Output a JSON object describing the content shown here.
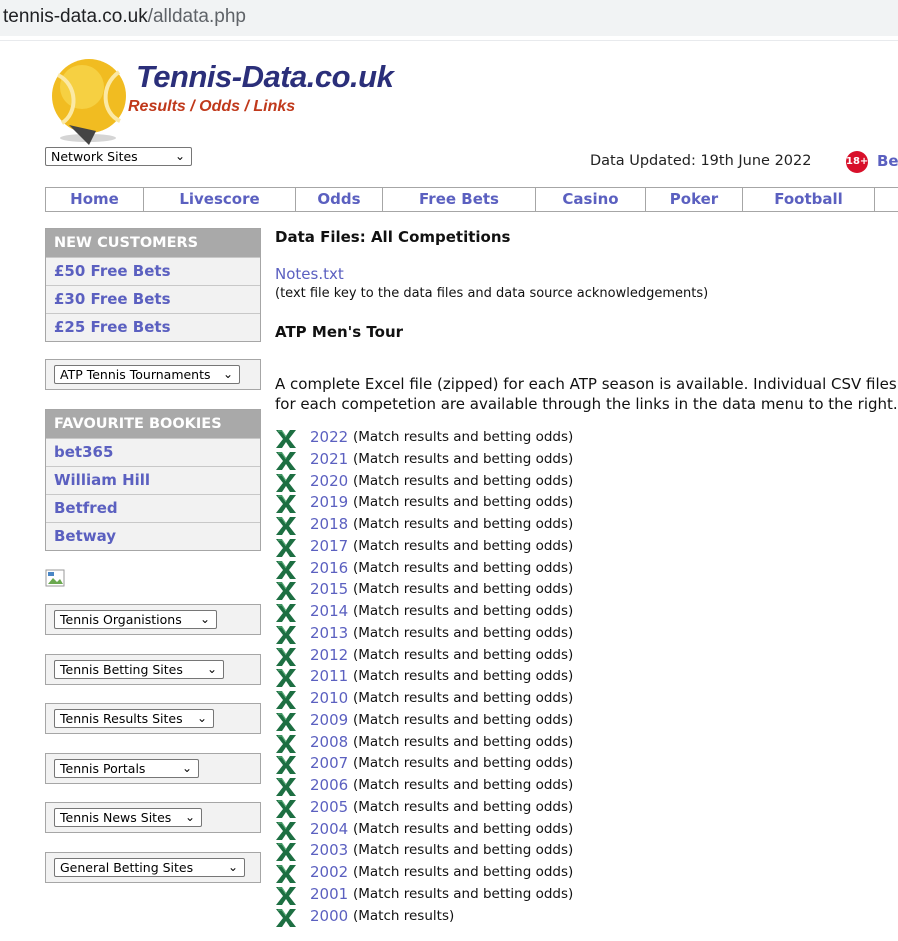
{
  "browser": {
    "url_host": "tennis-data.co.uk",
    "url_path": "/alldata.php"
  },
  "logo": {
    "title": "Tennis-Data.co.uk",
    "subtitle": "Results / Odds / Links"
  },
  "network_select": {
    "value": "Network Sites"
  },
  "updated": {
    "text": "Data Updated: 19th June 2022",
    "badge": "18+",
    "partial_text": "Be"
  },
  "nav": [
    "Home",
    "Livescore",
    "Odds",
    "Free Bets",
    "Casino",
    "Poker",
    "Football"
  ],
  "new_customers": {
    "title": "NEW CUSTOMERS",
    "items": [
      "£50 Free Bets",
      "£30 Free Bets",
      "£25 Free Bets"
    ]
  },
  "atp_select": {
    "value": "ATP Tennis Tournaments"
  },
  "bookies": {
    "title": "FAVOURITE BOOKIES",
    "items": [
      "bet365",
      "William Hill",
      "Betfred",
      "Betway"
    ]
  },
  "side_selects": [
    "Tennis Organistions",
    "Tennis Betting Sites",
    "Tennis Results Sites",
    "Tennis Portals",
    "Tennis News Sites",
    "General Betting Sites"
  ],
  "main": {
    "title": "Data Files: All Competitions",
    "notes_link": "Notes.txt",
    "notes_desc": "(text file key to the data files and data source acknowledgements)",
    "section": "ATP Men's Tour",
    "paragraph_line1": "A complete Excel file (zipped) for each ATP season is available. Individual CSV files",
    "paragraph_line2": "for each competetion are available through the links in the data menu to the right."
  },
  "years": [
    {
      "year": "2022",
      "desc": "(Match results and betting odds)"
    },
    {
      "year": "2021",
      "desc": "(Match results and betting odds)"
    },
    {
      "year": "2020",
      "desc": "(Match results and betting odds)"
    },
    {
      "year": "2019",
      "desc": "(Match results and betting odds)"
    },
    {
      "year": "2018",
      "desc": "(Match results and betting odds)"
    },
    {
      "year": "2017",
      "desc": "(Match results and betting odds)"
    },
    {
      "year": "2016",
      "desc": "(Match results and betting odds)"
    },
    {
      "year": "2015",
      "desc": "(Match results and betting odds)"
    },
    {
      "year": "2014",
      "desc": "(Match results and betting odds)"
    },
    {
      "year": "2013",
      "desc": "(Match results and betting odds)"
    },
    {
      "year": "2012",
      "desc": "(Match results and betting odds)"
    },
    {
      "year": "2011",
      "desc": "(Match results and betting odds)"
    },
    {
      "year": "2010",
      "desc": "(Match results and betting odds)"
    },
    {
      "year": "2009",
      "desc": "(Match results and betting odds)"
    },
    {
      "year": "2008",
      "desc": "(Match results and betting odds)"
    },
    {
      "year": "2007",
      "desc": "(Match results and betting odds)"
    },
    {
      "year": "2006",
      "desc": "(Match results and betting odds)"
    },
    {
      "year": "2005",
      "desc": "(Match results and betting odds)"
    },
    {
      "year": "2004",
      "desc": "(Match results and betting odds)"
    },
    {
      "year": "2003",
      "desc": "(Match results and betting odds)"
    },
    {
      "year": "2002",
      "desc": "(Match results and betting odds)"
    },
    {
      "year": "2001",
      "desc": "(Match results and betting odds)"
    },
    {
      "year": "2000",
      "desc": "(Match results)"
    }
  ],
  "colors": {
    "link": "#5b60c0",
    "box_header": "#a9a9a9",
    "box_row": "#f2f2f2",
    "logo_blue": "#2b2f7a",
    "logo_red": "#c0391b",
    "excel_green": "#1d6f42"
  },
  "icons": {
    "xl": "excel-icon",
    "chevron": "chevron-down-icon",
    "ball": "tennis-ball-icon",
    "age": "age-18-icon",
    "broken": "broken-image-icon"
  }
}
